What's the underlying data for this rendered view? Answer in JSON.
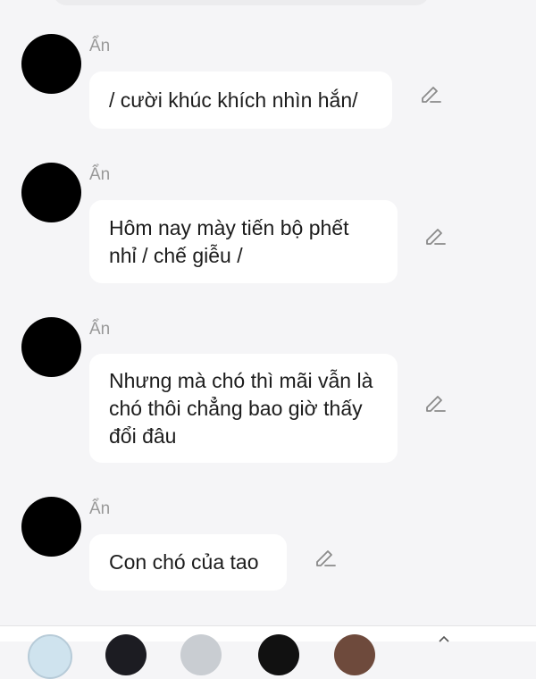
{
  "messages": [
    {
      "sender": "Ẩn",
      "text": "/ cười khúc khích nhìn hắn/"
    },
    {
      "sender": "Ẩn",
      "text": "Hôm nay mày tiến bộ phết nhỉ / chế giễu /"
    },
    {
      "sender": "Ẩn",
      "text": "Nhưng mà chó thì mãi vẫn là chó thôi chẳng bao giờ thấy đổi đâu"
    },
    {
      "sender": "Ẩn",
      "text": "Con chó của tao"
    }
  ],
  "icons": {
    "avatar": "avatar-placeholder",
    "edit": "pencil-icon"
  },
  "colors": {
    "background": "#f5f5f7",
    "bubble": "#ffffff",
    "text": "#1c1c1c",
    "sender": "#999999",
    "icon": "#8a8a8a"
  }
}
